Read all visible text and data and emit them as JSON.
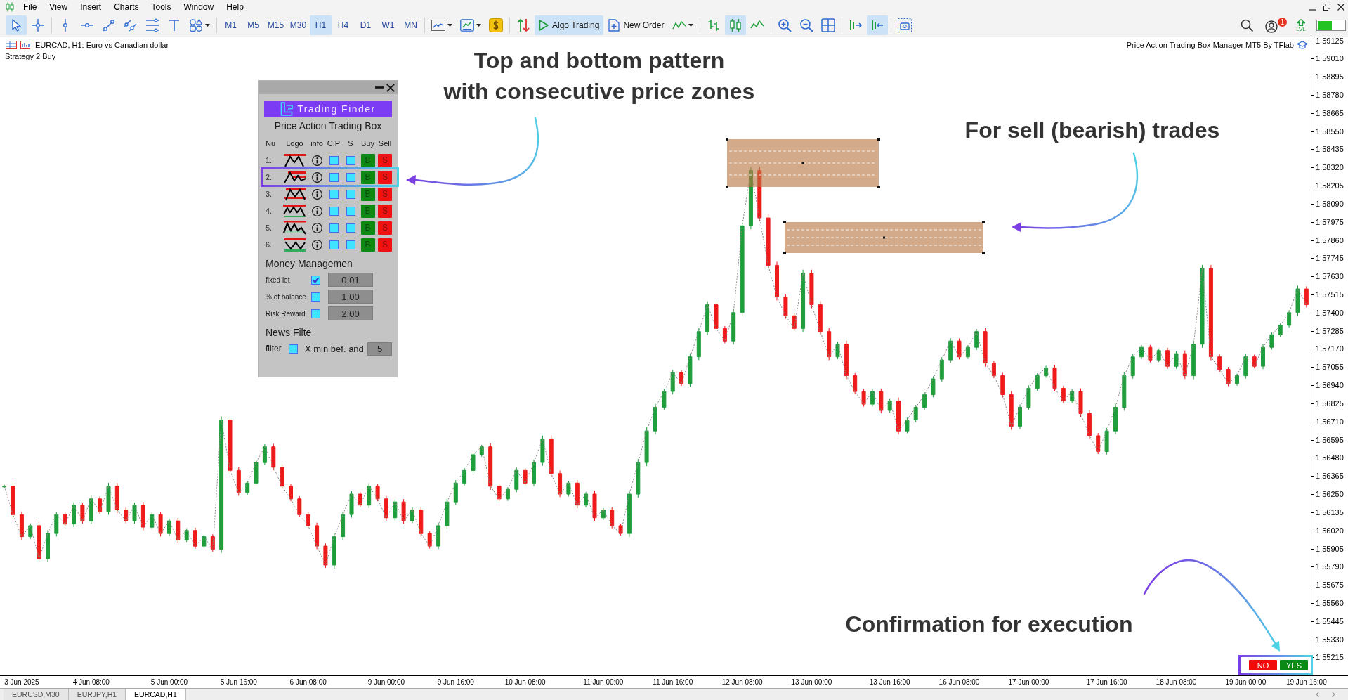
{
  "menu": [
    "File",
    "View",
    "Insert",
    "Charts",
    "Tools",
    "Window",
    "Help"
  ],
  "toolbar": {
    "drawing_tools": [
      {
        "kind": "cursor",
        "selected": true
      },
      {
        "kind": "crosshair",
        "selected": false
      },
      {
        "kind": "vertical-line",
        "selected": false
      },
      {
        "kind": "horizontal-line",
        "selected": false
      },
      {
        "kind": "trend-line",
        "selected": false
      },
      {
        "kind": "channel",
        "selected": false
      },
      {
        "kind": "levels",
        "selected": false
      },
      {
        "kind": "text",
        "selected": false
      },
      {
        "kind": "shapes",
        "selected": false
      }
    ],
    "timeframes": [
      {
        "label": "M1",
        "selected": false
      },
      {
        "label": "M5",
        "selected": false
      },
      {
        "label": "M15",
        "selected": false
      },
      {
        "label": "M30",
        "selected": false
      },
      {
        "label": "H1",
        "selected": true
      },
      {
        "label": "H4",
        "selected": false
      },
      {
        "label": "D1",
        "selected": false
      },
      {
        "label": "W1",
        "selected": false
      },
      {
        "label": "MN",
        "selected": false
      }
    ],
    "algo_trading": {
      "label": "Algo Trading",
      "on": true
    },
    "new_order": {
      "label": "New Order"
    },
    "chart_types": [
      {
        "kind": "bars",
        "selected": false
      },
      {
        "kind": "candles",
        "selected": true
      },
      {
        "kind": "line",
        "selected": false
      }
    ],
    "scroll_modes": [
      {
        "kind": "chart-shift",
        "on": false
      },
      {
        "kind": "auto-scroll",
        "on": true
      }
    ],
    "notification_count": "1",
    "level_label": "LVL"
  },
  "chart": {
    "symbol": "EURCAD, H1: Euro vs Canadian dollar",
    "comment": "Strategy 2 Buy",
    "indicator": "Price Action Trading Box Manager MT5 By TFlab",
    "chart_data": {
      "type": "line",
      "categories": [
        null,
        null,
        "3 Jun 2025",
        null,
        null,
        null,
        null,
        null,
        null,
        null,
        "4 Jun 08:00",
        null,
        null,
        null,
        null,
        null,
        null,
        null,
        null,
        "5 Jun 00:00",
        null,
        null,
        null,
        null,
        null,
        null,
        null,
        "5 Jun 16:00",
        null,
        null,
        null,
        null,
        null,
        null,
        null,
        "6 Jun 08:00",
        null,
        null,
        null,
        null,
        null,
        null,
        null,
        null,
        "9 Jun 00:00",
        null,
        null,
        null,
        null,
        null,
        null,
        null,
        "9 Jun 16:00",
        null,
        null,
        null,
        null,
        null,
        null,
        null,
        "10 Jun 08:00",
        null,
        null,
        null,
        null,
        null,
        null,
        null,
        null,
        "11 Jun 00:00",
        null,
        null,
        null,
        null,
        null,
        null,
        null,
        "11 Jun 16:00",
        null,
        null,
        null,
        null,
        null,
        null,
        null,
        "12 Jun 08:00",
        null,
        null,
        null,
        null,
        null,
        null,
        null,
        "13 Jun 00:00",
        null,
        null,
        null,
        null,
        null,
        null,
        null,
        null,
        "13 Jun 16:00",
        null,
        null,
        null,
        null,
        null,
        null,
        null,
        "16 Jun 08:00",
        null,
        null,
        null,
        null,
        null,
        null,
        null,
        "17 Jun 00:00",
        null,
        null,
        null,
        null,
        null,
        null,
        null,
        null,
        "17 Jun 16:00",
        null,
        null,
        null,
        null,
        null,
        null,
        null,
        "18 Jun 08:00",
        null,
        null,
        null,
        null,
        null,
        null,
        null,
        "19 Jun 00:00",
        null,
        null,
        null,
        null,
        null,
        null,
        "19 Jun 16:00"
      ],
      "series": [
        {
          "color": "#8a8a8a",
          "line_style": "dotted",
          "values": [
            1.563,
            1.5612,
            1.5598,
            1.5605,
            1.5584,
            1.56,
            1.5612,
            1.5606,
            1.5618,
            1.5608,
            1.5622,
            1.5614,
            1.563,
            1.5615,
            1.5608,
            1.5618,
            1.5604,
            1.5612,
            1.56,
            1.5608,
            1.5596,
            1.5602,
            1.5592,
            1.5598,
            1.559,
            1.5672,
            1.564,
            1.5626,
            1.5632,
            1.5645,
            1.5655,
            1.5642,
            1.563,
            1.5622,
            1.5612,
            1.5605,
            1.5592,
            1.558,
            1.5598,
            1.5612,
            1.5625,
            1.5618,
            1.563,
            1.5622,
            1.561,
            1.562,
            1.5608,
            1.5615,
            1.56,
            1.5592,
            1.5605,
            1.562,
            1.5632,
            1.564,
            1.565,
            1.5655,
            1.563,
            1.5622,
            1.5628,
            1.564,
            1.5632,
            1.5645,
            1.566,
            1.5638,
            1.5625,
            1.5632,
            1.5618,
            1.5625,
            1.561,
            1.5615,
            1.5605,
            1.56,
            1.5625,
            1.5645,
            1.5665,
            1.568,
            1.569,
            1.5702,
            1.5695,
            1.5712,
            1.5728,
            1.5745,
            1.573,
            1.5722,
            1.574,
            1.5795,
            1.583,
            1.58,
            1.577,
            1.575,
            1.5738,
            1.573,
            1.5765,
            1.5745,
            1.5728,
            1.5712,
            1.572,
            1.57,
            1.569,
            1.5682,
            1.569,
            1.5678,
            1.5684,
            1.5665,
            1.5672,
            1.568,
            1.5688,
            1.5698,
            1.571,
            1.5722,
            1.5712,
            1.5718,
            1.5728,
            1.5708,
            1.57,
            1.5688,
            1.5668,
            1.568,
            1.5692,
            1.57,
            1.5705,
            1.5692,
            1.5684,
            1.569,
            1.5676,
            1.5662,
            1.5652,
            1.5665,
            1.568,
            1.57,
            1.5712,
            1.5718,
            1.571,
            1.5716,
            1.5706,
            1.5714,
            1.57,
            1.572,
            1.5768,
            1.5712,
            1.5704,
            1.5695,
            1.57,
            1.5712,
            1.5706,
            1.5718,
            1.5726,
            1.5732,
            1.574,
            1.5755,
            1.5745
          ]
        }
      ],
      "ylim": [
        1.55101,
        1.59145
      ],
      "yticks": [
        {
          "value": 1.59125,
          "label": "1.59125"
        },
        {
          "value": 1.5901,
          "label": "1.59010"
        },
        {
          "value": 1.58895,
          "label": "1.58895"
        },
        {
          "value": 1.5878,
          "label": "1.58780"
        },
        {
          "value": 1.58665,
          "label": "1.58665"
        },
        {
          "value": 1.5855,
          "label": "1.58550"
        },
        {
          "value": 1.58435,
          "label": "1.58435"
        },
        {
          "value": 1.5832,
          "label": "1.58320"
        },
        {
          "value": 1.58205,
          "label": "1.58205"
        },
        {
          "value": 1.5809,
          "label": "1.58090"
        },
        {
          "value": 1.57975,
          "label": "1.57975"
        },
        {
          "value": 1.5786,
          "label": "1.57860"
        },
        {
          "value": 1.57745,
          "label": "1.57745"
        },
        {
          "value": 1.5763,
          "label": "1.57630"
        },
        {
          "value": 1.57515,
          "label": "1.57515"
        },
        {
          "value": 1.574,
          "label": "1.57400"
        },
        {
          "value": 1.57285,
          "label": "1.57285"
        },
        {
          "value": 1.5717,
          "label": "1.57170"
        },
        {
          "value": 1.57055,
          "label": "1.57055"
        },
        {
          "value": 1.5694,
          "label": "1.56940"
        },
        {
          "value": 1.56825,
          "label": "1.56825"
        },
        {
          "value": 1.5671,
          "label": "1.56710"
        },
        {
          "value": 1.56595,
          "label": "1.56595"
        },
        {
          "value": 1.5648,
          "label": "1.56480"
        },
        {
          "value": 1.56365,
          "label": "1.56365"
        },
        {
          "value": 1.5625,
          "label": "1.56250"
        },
        {
          "value": 1.56135,
          "label": "1.56135"
        },
        {
          "value": 1.5602,
          "label": "1.56020"
        },
        {
          "value": 1.55905,
          "label": "1.55905"
        },
        {
          "value": 1.5579,
          "label": "1.55790"
        },
        {
          "value": 1.55675,
          "label": "1.55675"
        },
        {
          "value": 1.5556,
          "label": "1.55560"
        },
        {
          "value": 1.55445,
          "label": "1.55445"
        },
        {
          "value": 1.5533,
          "label": "1.55330"
        },
        {
          "value": 1.55215,
          "label": "1.55215"
        }
      ]
    }
  },
  "panel": {
    "brand": "Trading Finder",
    "title": "Price Action Trading Box",
    "columns": [
      "Nu",
      "Logo",
      "info",
      "C.P",
      "S",
      "Buy",
      "Sell"
    ],
    "rows": [
      {
        "number": "1.",
        "kind": "single-zone",
        "cp_checked": false,
        "s_checked": false,
        "buy": "B",
        "sell": "S",
        "highlighted": false
      },
      {
        "number": "2.",
        "kind": "double-zone",
        "cp_checked": false,
        "s_checked": false,
        "buy": "B",
        "sell": "S",
        "highlighted": true
      },
      {
        "number": "3.",
        "kind": "crossed-zone",
        "cp_checked": false,
        "s_checked": false,
        "buy": "B",
        "sell": "S",
        "highlighted": false
      },
      {
        "number": "4.",
        "kind": "triple-top",
        "cp_checked": false,
        "s_checked": false,
        "buy": "B",
        "sell": "S",
        "highlighted": false
      },
      {
        "number": "5.",
        "kind": "multi-top",
        "cp_checked": false,
        "s_checked": false,
        "buy": "B",
        "sell": "S",
        "highlighted": false
      },
      {
        "number": "6.",
        "kind": "range-v",
        "cp_checked": false,
        "s_checked": false,
        "buy": "B",
        "sell": "S",
        "highlighted": false
      }
    ],
    "money_title": "Money Managemen",
    "money_rows": [
      {
        "label": "fixed lot",
        "checked": true,
        "value": "0.01"
      },
      {
        "label": "% of balance",
        "checked": false,
        "value": "1.00"
      },
      {
        "label": "Risk Reward",
        "checked": false,
        "value": "2.00"
      }
    ],
    "news_title": "News Filte",
    "news_filter": {
      "label": "filter",
      "checked": false,
      "text": "X min bef. and",
      "value": "5"
    }
  },
  "annotations": [
    {
      "text": "Top and bottom pattern\nwith consecutive price zones"
    },
    {
      "text": "For sell (bearish) trades"
    },
    {
      "text": "Confirmation for execution"
    }
  ],
  "confirmation": {
    "highlighted": true,
    "buttons": [
      {
        "kind": "no",
        "label": "NO"
      },
      {
        "kind": "yes",
        "label": "YES"
      }
    ]
  },
  "tabs": [
    {
      "label": "EURUSD,M30",
      "selected": false
    },
    {
      "label": "EURJPY,H1",
      "selected": false
    },
    {
      "label": "EURCAD,H1",
      "selected": true
    }
  ]
}
